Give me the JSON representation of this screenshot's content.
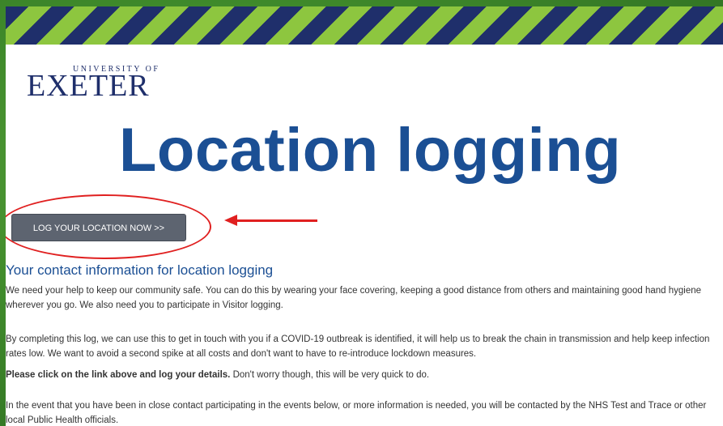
{
  "logo": {
    "small": "UNIVERSITY OF",
    "big": "EXETER"
  },
  "title": "Location logging",
  "cta_button": "LOG YOUR LOCATION NOW >>",
  "annotation_color": "#e02020",
  "heading": "Your contact information for location logging",
  "paragraphs": {
    "p1": "We need your help to keep our community safe. You can do this by wearing your face covering, keeping a good distance from others and maintaining good hand hygiene wherever you go. We also need you to participate in Visitor logging.",
    "p2": "By completing this log, we can use this to get in touch with you if a COVID-19 outbreak is identified, it will help us to break the chain in transmission and help keep infection rates low. We want to avoid a second spike at all costs and don't want to have to re-introduce lockdown measures.",
    "p3_bold": "Please click on the link above and log your details.",
    "p3_rest": " Don't worry though, this will be very quick to do.",
    "p4": "In the event that you have been in close contact participating in the events below, or more information is needed, you will be contacted by the NHS Test and Trace or other local Public Health officials."
  }
}
